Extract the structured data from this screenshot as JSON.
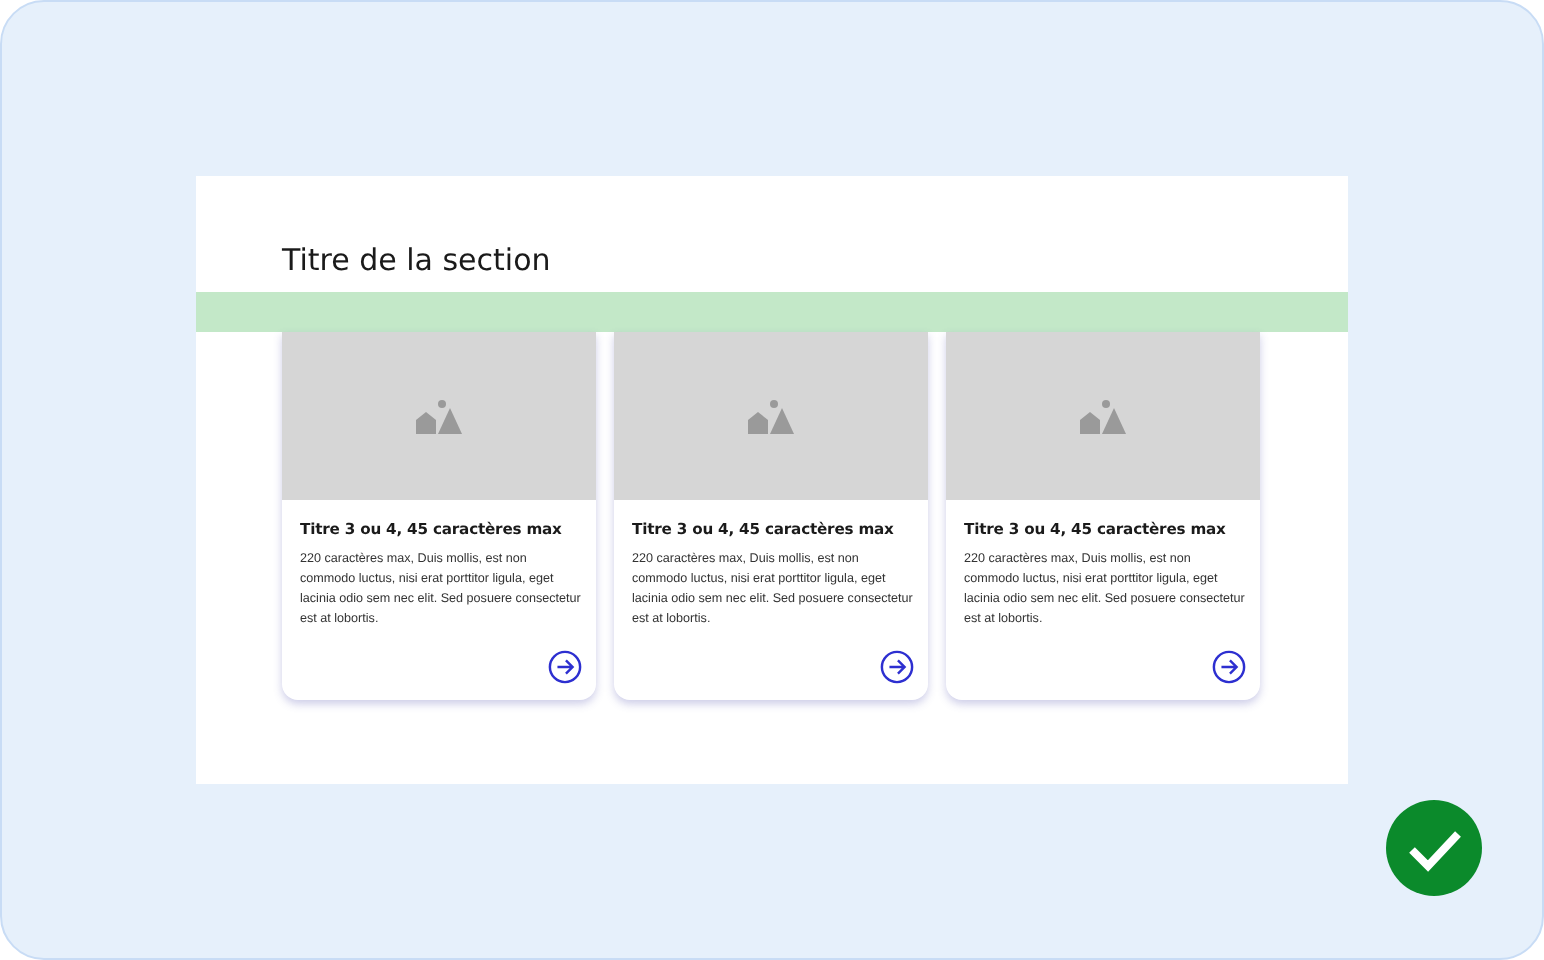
{
  "section": {
    "title": "Titre de la section"
  },
  "cards": [
    {
      "kind": "picture",
      "title": "Titre 3 ou 4, 45 caractères max",
      "body": "220 caractères max, Duis mollis, est non commodo luctus, nisi erat porttitor ligula, eget lacinia odio sem nec elit. Sed posuere consectetur est at lobortis."
    },
    {
      "kind": "picture",
      "title": "Titre 3 ou 4, 45 caractères max",
      "body": "220 caractères max, Duis mollis, est non commodo luctus, nisi erat porttitor ligula, eget lacinia odio sem nec elit. Sed posuere consectetur est at lobortis."
    },
    {
      "kind": "picture",
      "title": "Titre 3 ou 4, 45 caractères max",
      "body": "220 caractères max, Duis mollis, est non commodo luctus, nisi erat porttitor ligula, eget lacinia odio sem nec elit. Sed posuere consectetur est at lobortis."
    }
  ]
}
